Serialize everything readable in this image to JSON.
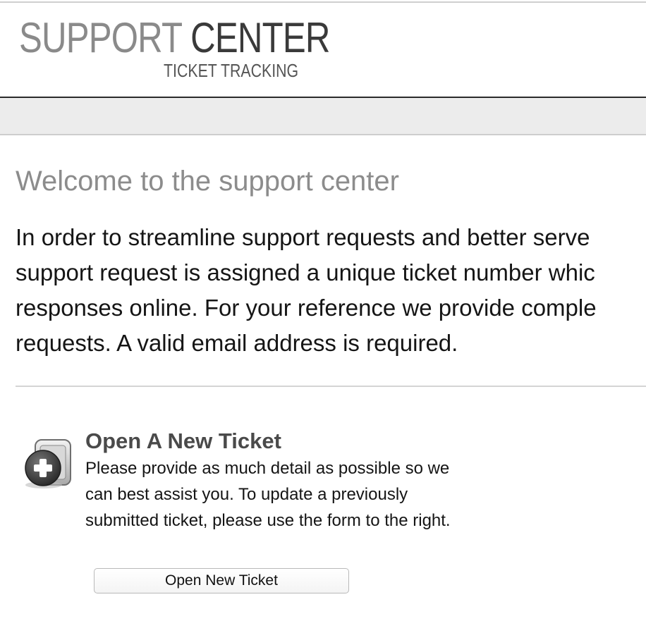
{
  "header": {
    "logo_word_1": "SUPPORT",
    "logo_word_2": "CENTER",
    "logo_subtitle": "TICKET TRACKING"
  },
  "main": {
    "welcome_title": "Welcome to the support center",
    "intro_lines": [
      "In order to streamline support requests and better serve",
      "support request is assigned a unique ticket number whic",
      "responses online. For your reference we provide comple",
      "requests. A valid email address is required."
    ]
  },
  "open_ticket": {
    "icon": "add-ticket-icon",
    "title": "Open A New Ticket",
    "description_lines": [
      "Please provide as much detail as possible so we",
      "can best assist you. To update a previously",
      "submitted ticket, please use the form to the right."
    ],
    "button_label": "Open New Ticket"
  },
  "colors": {
    "nav_bar": "#ececec",
    "header_rule": "#2a2a2a",
    "title_gray": "#8c8c8c",
    "heading_dark_gray": "#4a4a4a"
  }
}
